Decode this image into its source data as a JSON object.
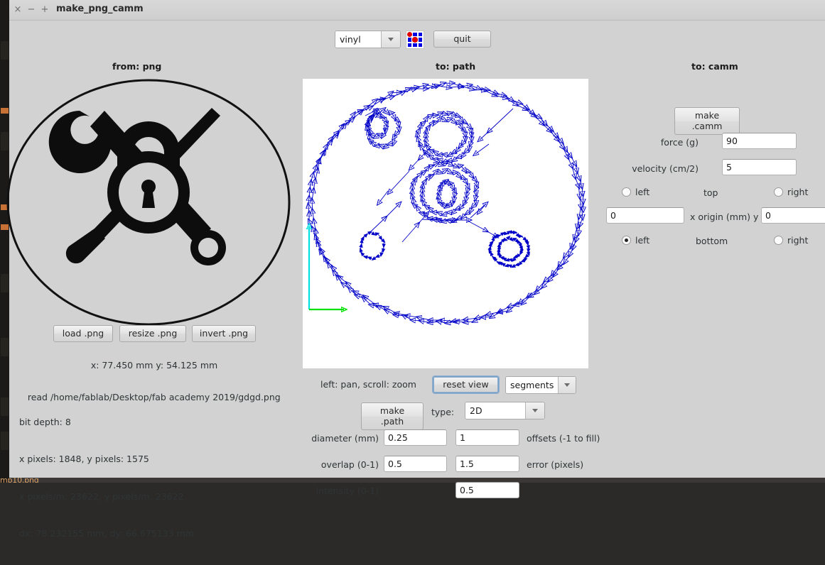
{
  "window": {
    "title": "make_png_camm",
    "close_icon": "×",
    "minimize_icon": "−",
    "maximize_icon": "+"
  },
  "toolbar": {
    "material_select": "vinyl",
    "grid_icon_name": "rgb-grid-icon",
    "quit_label": "quit"
  },
  "panels": {
    "png_header": "from: png",
    "path_header": "to: path",
    "camm_header": "to: camm"
  },
  "png_panel": {
    "load_label": "load .png",
    "resize_label": "resize .png",
    "invert_label": "invert .png",
    "dimensions": "x: 77.450 mm  y: 54.125 mm",
    "info": {
      "read_line": "read /home/fablab/Desktop/fab academy 2019/gdgd.png",
      "bit_depth": "bit depth: 8",
      "pixels": "x pixels: 1848, y pixels: 1575",
      "pixels_per_m": "x pixels/m: 23622, y pixels/m: 23622",
      "deltas": "dx: 78.232155 mm, dy: 66.675133 mm"
    }
  },
  "path_panel": {
    "mouse_hint": "left: pan, scroll: zoom",
    "reset_view_label": "reset view",
    "display_select": "segments",
    "make_path_label": "make .path",
    "type_label": "type:",
    "type_select": "2D",
    "diameter_label": "diameter (mm)",
    "diameter_value": "0.25",
    "offsets_value": "1",
    "offsets_label": "offsets (-1 to fill)",
    "overlap_label": "overlap (0-1)",
    "overlap_value": "0.5",
    "error_value": "1.5",
    "error_label": "error (pixels)",
    "intensity_label": "intensity (0-1)",
    "intensity_value": "0.5"
  },
  "camm_panel": {
    "make_camm_label": "make .camm",
    "force_label": "force (g)",
    "force_value": "90",
    "velocity_label": "velocity (cm/2)",
    "velocity_value": "5",
    "top_label": "top",
    "bottom_label": "bottom",
    "left_label": "left",
    "right_label": "right",
    "origin_label": "x  origin (mm)  y",
    "origin_x": "0",
    "origin_y": "0",
    "selected_origin": "bottom-left"
  },
  "desktop": {
    "bottom_filename": "mp10.png"
  },
  "colors": {
    "window_bg": "#d2d2d2",
    "canvas_bg": "#ffffff",
    "path_stroke": "#0000c8",
    "axis_x": "#00e000",
    "axis_y": "#00e0e0",
    "accent_red": "#e00000",
    "accent_blue": "#0000e0",
    "focus_ring": "#8badd1"
  }
}
